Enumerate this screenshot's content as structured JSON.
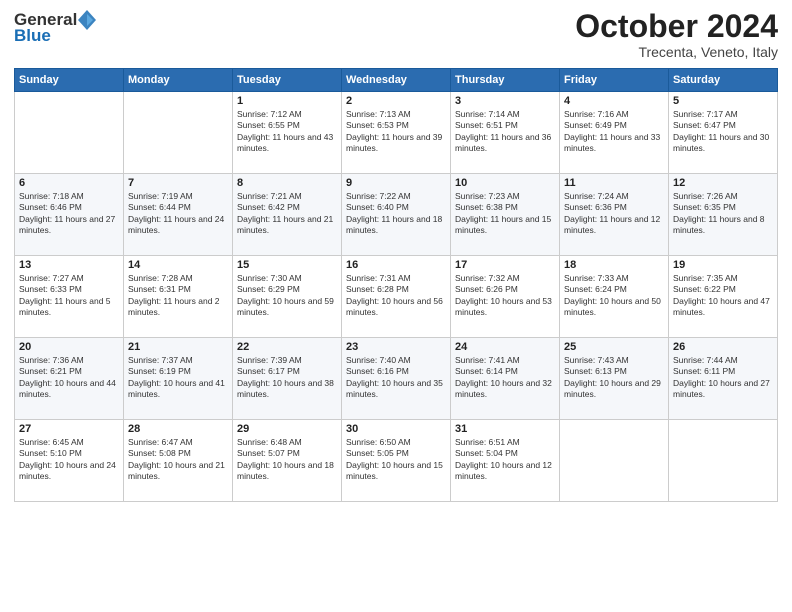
{
  "header": {
    "logo_general": "General",
    "logo_blue": "Blue",
    "month_title": "October 2024",
    "location": "Trecenta, Veneto, Italy"
  },
  "days_of_week": [
    "Sunday",
    "Monday",
    "Tuesday",
    "Wednesday",
    "Thursday",
    "Friday",
    "Saturday"
  ],
  "weeks": [
    [
      {
        "day": "",
        "sunrise": "",
        "sunset": "",
        "daylight": ""
      },
      {
        "day": "",
        "sunrise": "",
        "sunset": "",
        "daylight": ""
      },
      {
        "day": "1",
        "sunrise": "Sunrise: 7:12 AM",
        "sunset": "Sunset: 6:55 PM",
        "daylight": "Daylight: 11 hours and 43 minutes."
      },
      {
        "day": "2",
        "sunrise": "Sunrise: 7:13 AM",
        "sunset": "Sunset: 6:53 PM",
        "daylight": "Daylight: 11 hours and 39 minutes."
      },
      {
        "day": "3",
        "sunrise": "Sunrise: 7:14 AM",
        "sunset": "Sunset: 6:51 PM",
        "daylight": "Daylight: 11 hours and 36 minutes."
      },
      {
        "day": "4",
        "sunrise": "Sunrise: 7:16 AM",
        "sunset": "Sunset: 6:49 PM",
        "daylight": "Daylight: 11 hours and 33 minutes."
      },
      {
        "day": "5",
        "sunrise": "Sunrise: 7:17 AM",
        "sunset": "Sunset: 6:47 PM",
        "daylight": "Daylight: 11 hours and 30 minutes."
      }
    ],
    [
      {
        "day": "6",
        "sunrise": "Sunrise: 7:18 AM",
        "sunset": "Sunset: 6:46 PM",
        "daylight": "Daylight: 11 hours and 27 minutes."
      },
      {
        "day": "7",
        "sunrise": "Sunrise: 7:19 AM",
        "sunset": "Sunset: 6:44 PM",
        "daylight": "Daylight: 11 hours and 24 minutes."
      },
      {
        "day": "8",
        "sunrise": "Sunrise: 7:21 AM",
        "sunset": "Sunset: 6:42 PM",
        "daylight": "Daylight: 11 hours and 21 minutes."
      },
      {
        "day": "9",
        "sunrise": "Sunrise: 7:22 AM",
        "sunset": "Sunset: 6:40 PM",
        "daylight": "Daylight: 11 hours and 18 minutes."
      },
      {
        "day": "10",
        "sunrise": "Sunrise: 7:23 AM",
        "sunset": "Sunset: 6:38 PM",
        "daylight": "Daylight: 11 hours and 15 minutes."
      },
      {
        "day": "11",
        "sunrise": "Sunrise: 7:24 AM",
        "sunset": "Sunset: 6:36 PM",
        "daylight": "Daylight: 11 hours and 12 minutes."
      },
      {
        "day": "12",
        "sunrise": "Sunrise: 7:26 AM",
        "sunset": "Sunset: 6:35 PM",
        "daylight": "Daylight: 11 hours and 8 minutes."
      }
    ],
    [
      {
        "day": "13",
        "sunrise": "Sunrise: 7:27 AM",
        "sunset": "Sunset: 6:33 PM",
        "daylight": "Daylight: 11 hours and 5 minutes."
      },
      {
        "day": "14",
        "sunrise": "Sunrise: 7:28 AM",
        "sunset": "Sunset: 6:31 PM",
        "daylight": "Daylight: 11 hours and 2 minutes."
      },
      {
        "day": "15",
        "sunrise": "Sunrise: 7:30 AM",
        "sunset": "Sunset: 6:29 PM",
        "daylight": "Daylight: 10 hours and 59 minutes."
      },
      {
        "day": "16",
        "sunrise": "Sunrise: 7:31 AM",
        "sunset": "Sunset: 6:28 PM",
        "daylight": "Daylight: 10 hours and 56 minutes."
      },
      {
        "day": "17",
        "sunrise": "Sunrise: 7:32 AM",
        "sunset": "Sunset: 6:26 PM",
        "daylight": "Daylight: 10 hours and 53 minutes."
      },
      {
        "day": "18",
        "sunrise": "Sunrise: 7:33 AM",
        "sunset": "Sunset: 6:24 PM",
        "daylight": "Daylight: 10 hours and 50 minutes."
      },
      {
        "day": "19",
        "sunrise": "Sunrise: 7:35 AM",
        "sunset": "Sunset: 6:22 PM",
        "daylight": "Daylight: 10 hours and 47 minutes."
      }
    ],
    [
      {
        "day": "20",
        "sunrise": "Sunrise: 7:36 AM",
        "sunset": "Sunset: 6:21 PM",
        "daylight": "Daylight: 10 hours and 44 minutes."
      },
      {
        "day": "21",
        "sunrise": "Sunrise: 7:37 AM",
        "sunset": "Sunset: 6:19 PM",
        "daylight": "Daylight: 10 hours and 41 minutes."
      },
      {
        "day": "22",
        "sunrise": "Sunrise: 7:39 AM",
        "sunset": "Sunset: 6:17 PM",
        "daylight": "Daylight: 10 hours and 38 minutes."
      },
      {
        "day": "23",
        "sunrise": "Sunrise: 7:40 AM",
        "sunset": "Sunset: 6:16 PM",
        "daylight": "Daylight: 10 hours and 35 minutes."
      },
      {
        "day": "24",
        "sunrise": "Sunrise: 7:41 AM",
        "sunset": "Sunset: 6:14 PM",
        "daylight": "Daylight: 10 hours and 32 minutes."
      },
      {
        "day": "25",
        "sunrise": "Sunrise: 7:43 AM",
        "sunset": "Sunset: 6:13 PM",
        "daylight": "Daylight: 10 hours and 29 minutes."
      },
      {
        "day": "26",
        "sunrise": "Sunrise: 7:44 AM",
        "sunset": "Sunset: 6:11 PM",
        "daylight": "Daylight: 10 hours and 27 minutes."
      }
    ],
    [
      {
        "day": "27",
        "sunrise": "Sunrise: 6:45 AM",
        "sunset": "Sunset: 5:10 PM",
        "daylight": "Daylight: 10 hours and 24 minutes."
      },
      {
        "day": "28",
        "sunrise": "Sunrise: 6:47 AM",
        "sunset": "Sunset: 5:08 PM",
        "daylight": "Daylight: 10 hours and 21 minutes."
      },
      {
        "day": "29",
        "sunrise": "Sunrise: 6:48 AM",
        "sunset": "Sunset: 5:07 PM",
        "daylight": "Daylight: 10 hours and 18 minutes."
      },
      {
        "day": "30",
        "sunrise": "Sunrise: 6:50 AM",
        "sunset": "Sunset: 5:05 PM",
        "daylight": "Daylight: 10 hours and 15 minutes."
      },
      {
        "day": "31",
        "sunrise": "Sunrise: 6:51 AM",
        "sunset": "Sunset: 5:04 PM",
        "daylight": "Daylight: 10 hours and 12 minutes."
      },
      {
        "day": "",
        "sunrise": "",
        "sunset": "",
        "daylight": ""
      },
      {
        "day": "",
        "sunrise": "",
        "sunset": "",
        "daylight": ""
      }
    ]
  ]
}
